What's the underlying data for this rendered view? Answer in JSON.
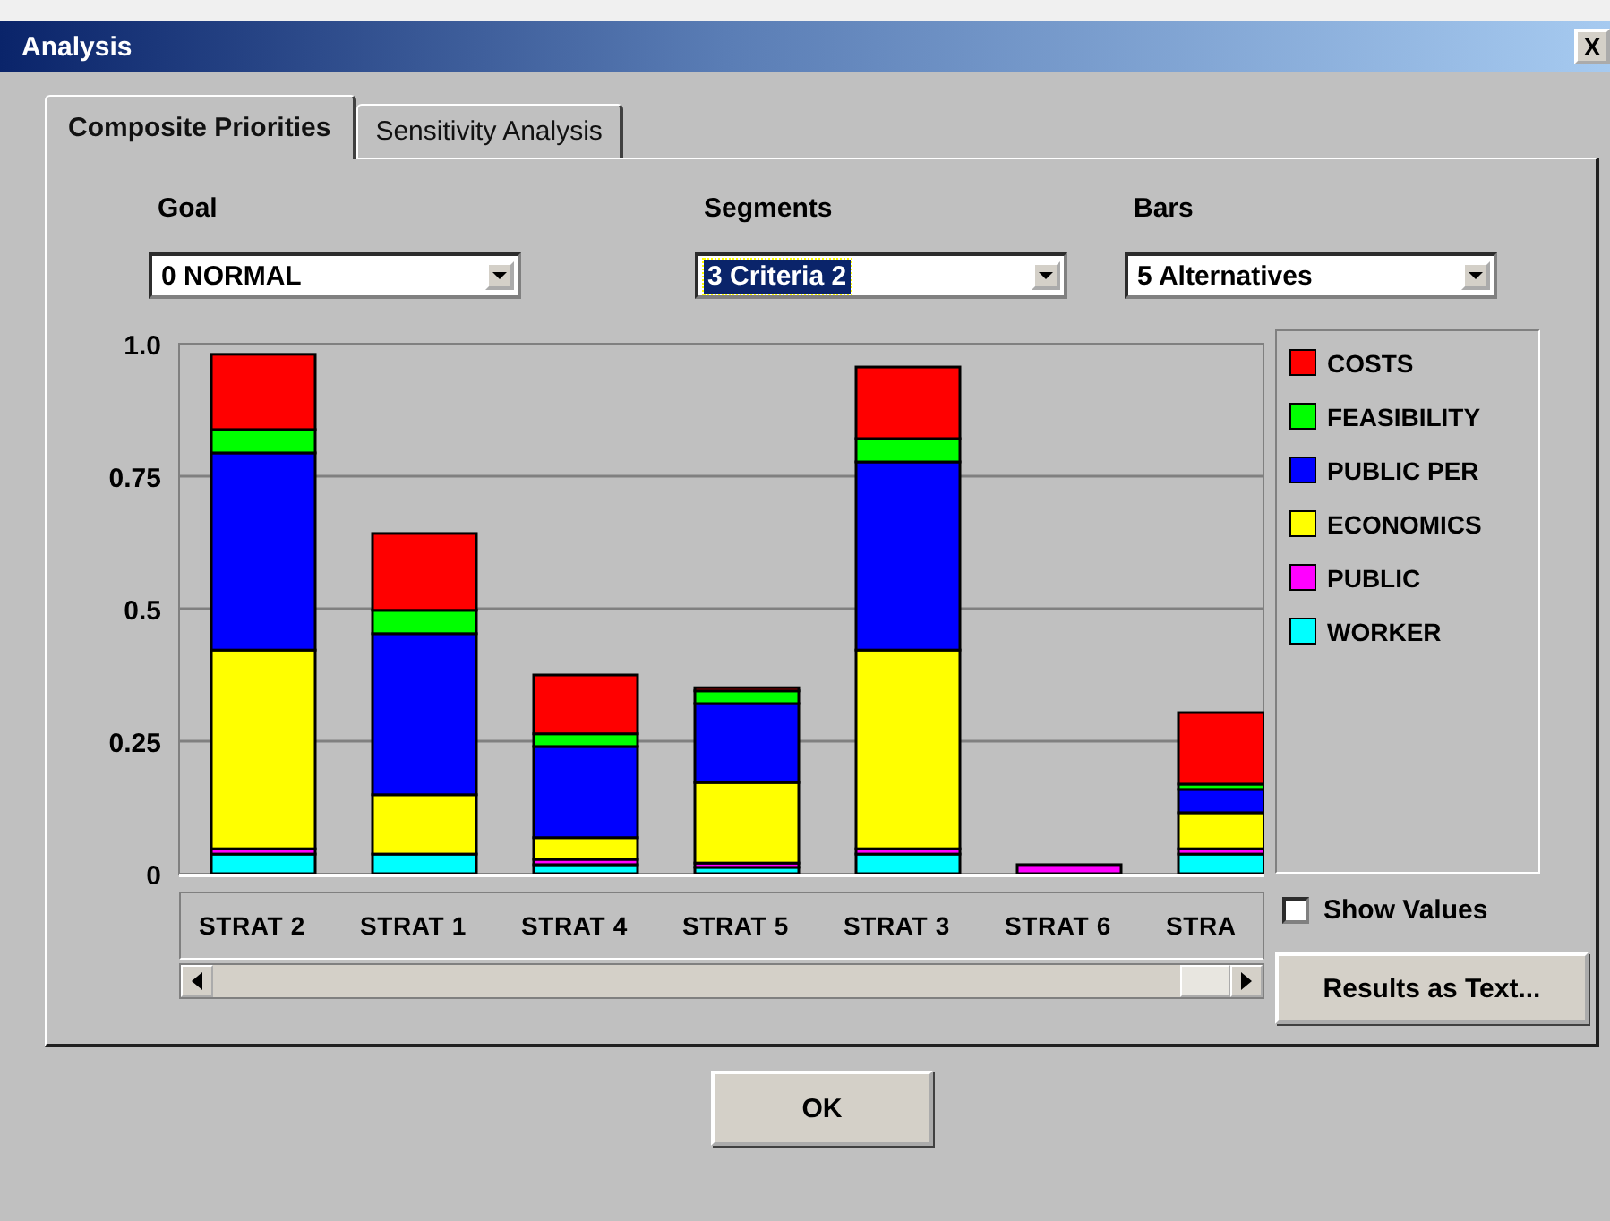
{
  "window": {
    "title": "Analysis",
    "close": "X"
  },
  "tabs": [
    {
      "label": "Composite Priorities",
      "selected": true
    },
    {
      "label": "Sensitivity Analysis",
      "selected": false
    }
  ],
  "selectors": [
    {
      "label": "Goal",
      "value": "0 NORMAL",
      "focused": false
    },
    {
      "label": "Segments",
      "value": "3 Criteria 2",
      "focused": true
    },
    {
      "label": "Bars",
      "value": "5 Alternatives",
      "focused": false
    }
  ],
  "chart_data": {
    "type": "bar",
    "stacked": true,
    "grid": true,
    "ylim": [
      0,
      1
    ],
    "yticks": [
      0,
      0.25,
      0.5,
      0.75,
      {
        "value": 1,
        "label": "1.0"
      }
    ],
    "categories": [
      "STRAT 2",
      "STRAT 1",
      "STRAT 4",
      "STRAT 5",
      "STRAT 3",
      "STRAT 6",
      "STRA"
    ],
    "series": [
      {
        "name": "COSTS",
        "color": "#ff0000",
        "values": [
          0.142,
          0.145,
          0.111,
          0.006,
          0.135,
          0,
          0.135
        ]
      },
      {
        "name": "FEASIBILITY",
        "color": "#00ff00",
        "values": [
          0.044,
          0.044,
          0.024,
          0.024,
          0.044,
          0,
          0.01
        ]
      },
      {
        "name": "PUBLIC PER",
        "color": "#0000ff",
        "values": [
          0.372,
          0.304,
          0.172,
          0.149,
          0.355,
          0,
          0.044
        ]
      },
      {
        "name": "ECONOMICS",
        "color": "#ffff00",
        "values": [
          0.375,
          0.112,
          0.041,
          0.152,
          0.375,
          0,
          0.068
        ]
      },
      {
        "name": "PUBLIC",
        "color": "#ff00ff",
        "values": [
          0.01,
          null,
          0.01,
          0.008,
          0.01,
          0.017,
          0.01
        ]
      },
      {
        "name": "WORKER",
        "color": "#00ffff",
        "values": [
          0.037,
          0.037,
          0.017,
          0.012,
          0.037,
          0,
          0.037
        ]
      }
    ]
  },
  "show_values": {
    "label": "Show Values",
    "checked": false
  },
  "results_button": "Results as Text...",
  "ok_button": "OK"
}
